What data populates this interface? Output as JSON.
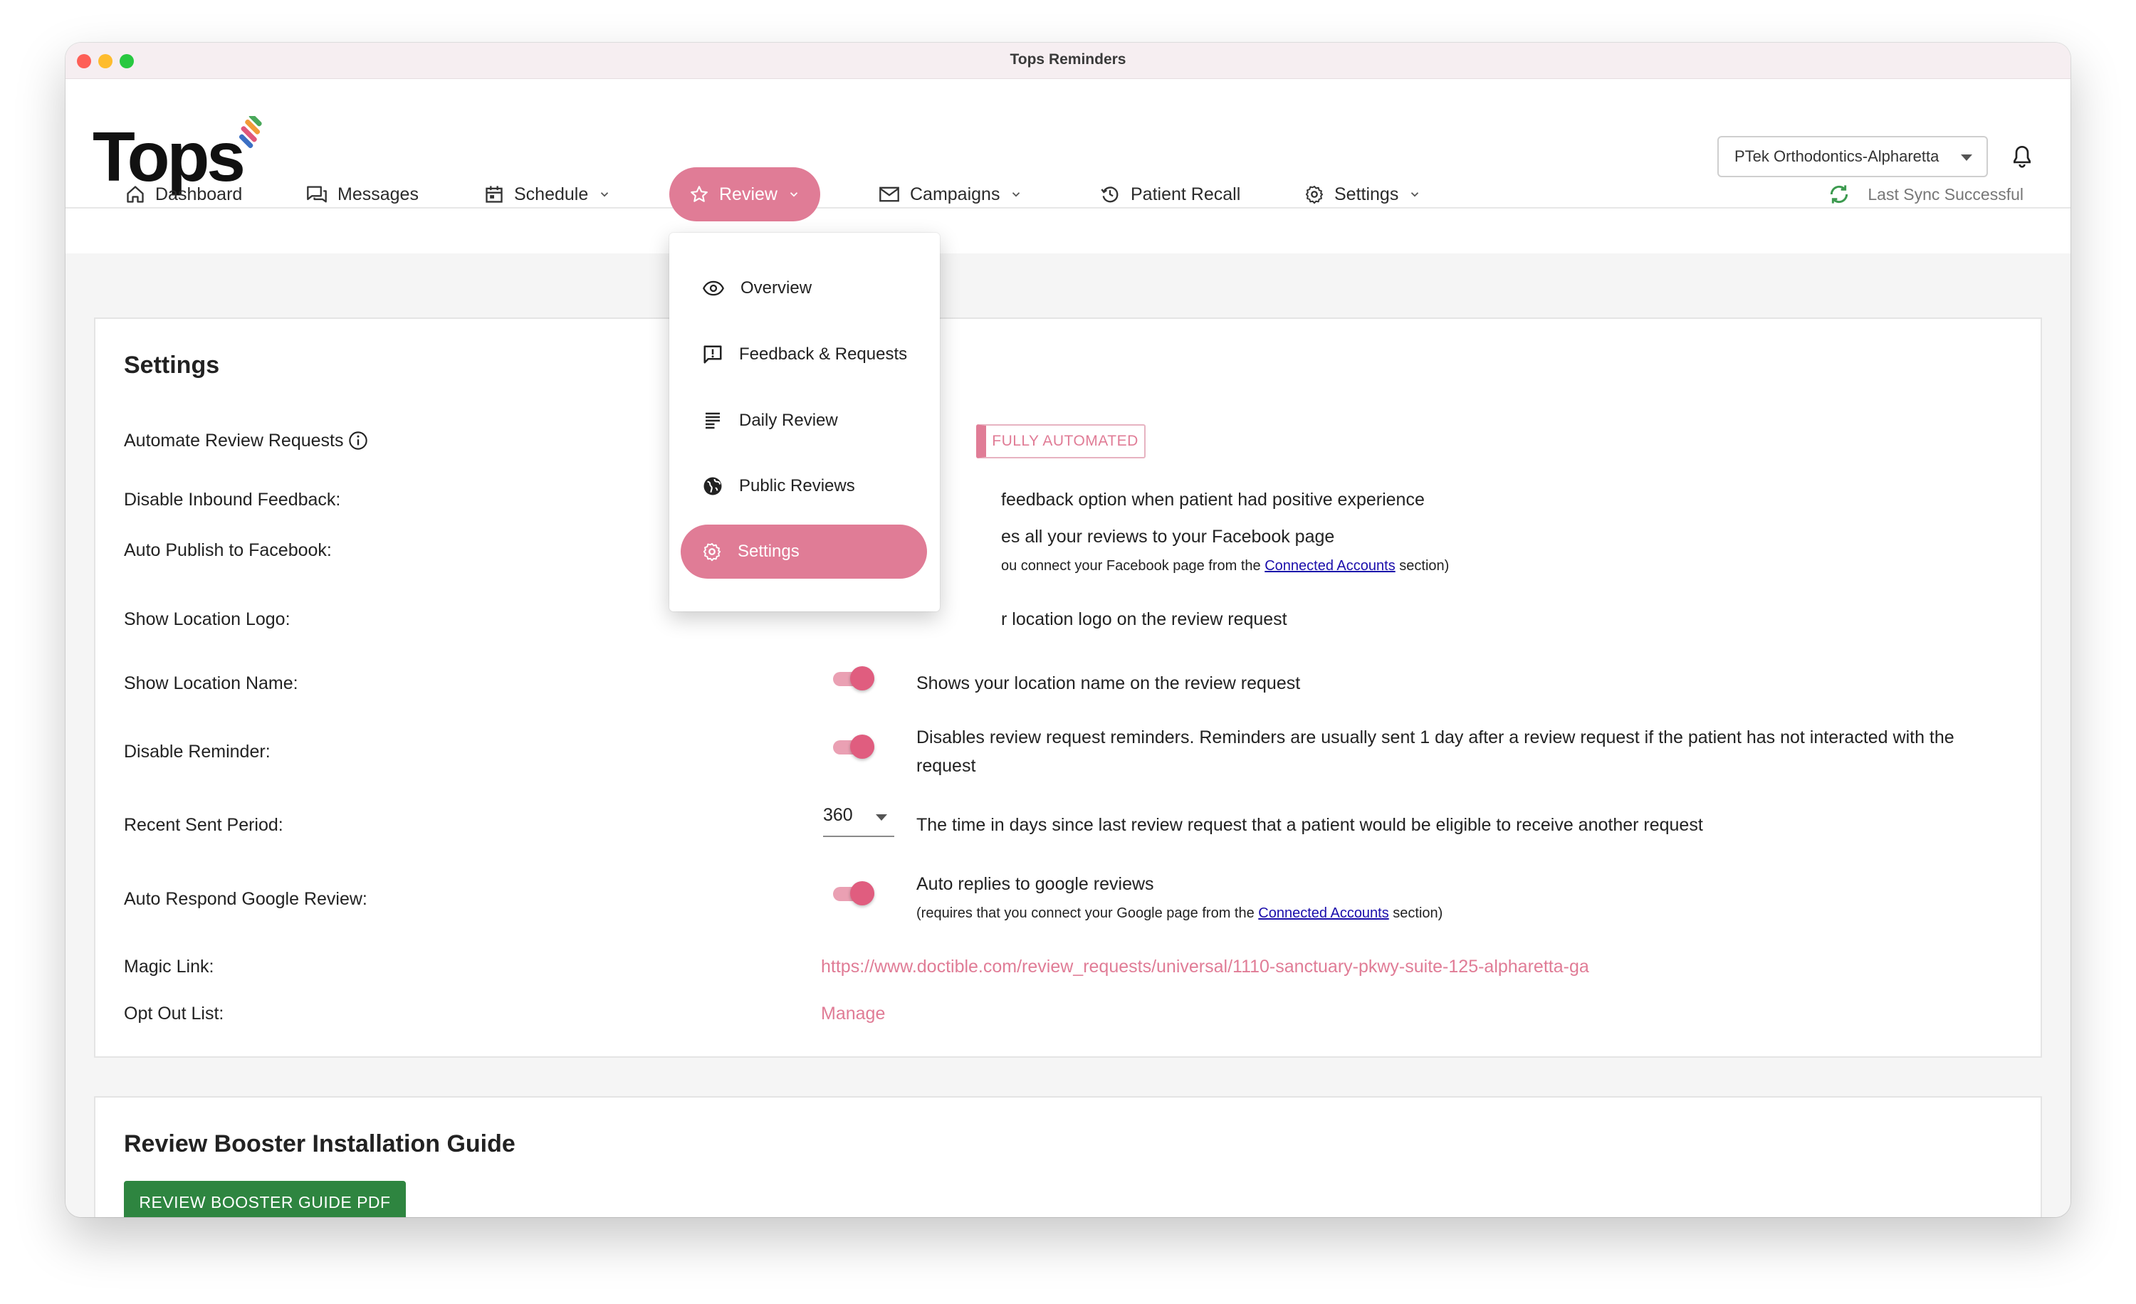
{
  "window": {
    "title": "Tops Reminders"
  },
  "header": {
    "logo_text": "Tops",
    "location": "PTek Orthodontics-Alpharetta"
  },
  "nav": {
    "dashboard": "Dashboard",
    "messages": "Messages",
    "schedule": "Schedule",
    "review": "Review",
    "campaigns": "Campaigns",
    "patient_recall": "Patient Recall",
    "settings": "Settings",
    "sync_status": "Last Sync Successful"
  },
  "review_menu": {
    "items": [
      "Overview",
      "Feedback & Requests",
      "Daily Review",
      "Public Reviews",
      "Settings"
    ],
    "active": "Settings"
  },
  "settings_card": {
    "title": "Settings",
    "automate_label": "Automate Review Requests",
    "automate_mode": "FULLY AUTOMATED",
    "disable_inbound_label": "Disable Inbound Feedback:",
    "disable_inbound_desc": "feedback option when patient had positive experience",
    "auto_publish_label": "Auto Publish to Facebook:",
    "auto_publish_desc": "es all your reviews to your Facebook page",
    "auto_publish_note_pre": "ou connect your Facebook page from the ",
    "auto_publish_note_link": "Connected Accounts",
    "auto_publish_note_post": " section)",
    "show_logo_label": "Show Location Logo:",
    "show_logo_desc": "r location logo on the review request",
    "show_name_label": "Show Location Name:",
    "show_name_desc": "Shows your location name on the review request",
    "show_name_on": true,
    "disable_reminder_label": "Disable Reminder:",
    "disable_reminder_desc_1": "Disables review request reminders. Reminders are usually sent 1 day after a review request if the patient has not interacted with the",
    "disable_reminder_desc_2": "request",
    "disable_reminder_on": true,
    "recent_sent_label": "Recent Sent Period:",
    "recent_sent_value": "360",
    "recent_sent_desc": "The time in days since last review request that a patient would be eligible to receive another request",
    "auto_respond_label": "Auto Respond Google Review:",
    "auto_respond_desc": "Auto replies to google reviews",
    "auto_respond_note_pre": "(requires that you connect your Google page from the ",
    "auto_respond_note_link": "Connected Accounts",
    "auto_respond_note_post": " section)",
    "auto_respond_on": true,
    "magic_link_label": "Magic Link:",
    "magic_link_url": "https://www.doctible.com/review_requests/universal/1110-sanctuary-pkwy-suite-125-alpharetta-ga",
    "opt_out_label": "Opt Out List:",
    "opt_out_link": "Manage"
  },
  "guide_card": {
    "title": "Review Booster Installation Guide",
    "button": "REVIEW BOOSTER GUIDE PDF"
  },
  "colors": {
    "accent": "#e07c96",
    "toggle_knob": "#e05d7f",
    "guide_button": "#2e8540",
    "sync_icon": "#3c9a4f",
    "link_blue": "#1a0dab"
  }
}
